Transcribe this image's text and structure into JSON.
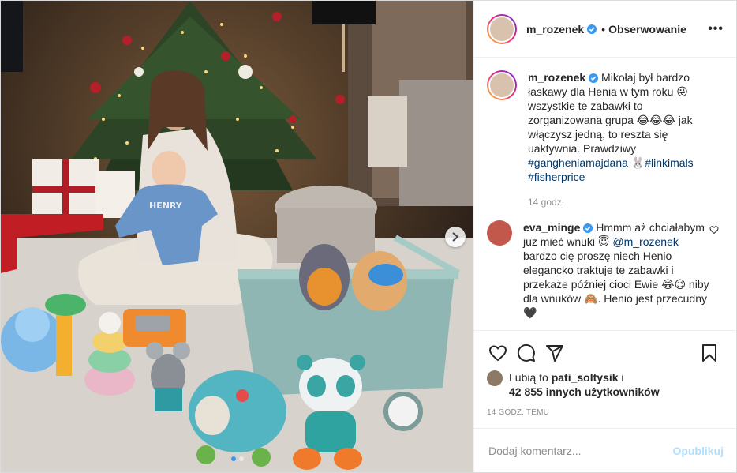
{
  "post": {
    "username": "m_rozenek",
    "separator": "•",
    "follow_label": "Obserwowanie",
    "more_label": "•••"
  },
  "caption": {
    "username": "m_rozenek",
    "text": "Mikołaj był bardzo łaskawy dla Henia w tym roku 😜 wszystkie te zabawki to zorganizowana grupa 😂😂😂 jak włączysz jedną, to reszta się uaktywnia. Prawdziwy ",
    "hashtag1": "#gangheniamajdana",
    "mid": " 🐰",
    "hashtag2": "#linkimals",
    "hashtag3": "#fisherprice",
    "time": "14 godz."
  },
  "comment": {
    "username": "eva_minge",
    "text_a": "Hmmm aż chciałabym już mieć wnuki 😇 ",
    "mention": "@m_rozenek",
    "text_b": " bardzo cię proszę niech Henio elegancko traktuje te zabawki i przekaże później cioci Ewie 😂😉 niby dla wnuków 🙈. Henio jest przecudny 🖤"
  },
  "likes": {
    "prefix": "Lubią to ",
    "user": "pati_soltysik",
    "and": " i",
    "others": "42 855 innych użytkowników"
  },
  "posted_time": "14 GODZ. TEMU",
  "add_comment": {
    "placeholder": "Dodaj komentarz...",
    "publish_label": "Opublikuj"
  },
  "colors": {
    "verified": "#3897f0",
    "link": "#00376b",
    "publish_disabled": "#b2dffc"
  },
  "icons": [
    "verified-badge-icon",
    "heart-icon",
    "comment-icon",
    "share-icon",
    "bookmark-icon",
    "chevron-right-icon",
    "more-icon"
  ]
}
